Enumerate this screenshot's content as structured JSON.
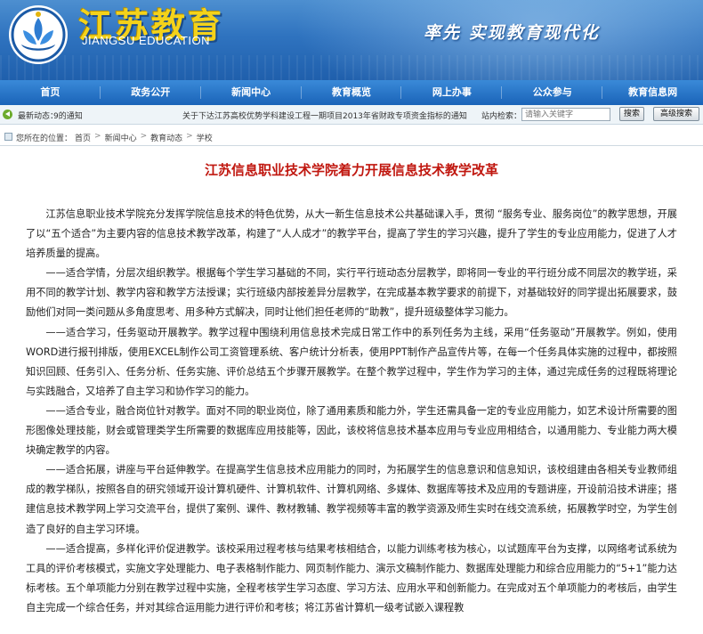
{
  "header": {
    "logo_cn": "江苏教育",
    "logo_en": "JIANGSU EDUCATION",
    "slogan": "率先 实现教育现代化",
    "colors": {
      "banner": "#2f73bf",
      "logo_text": "#f4d21a"
    }
  },
  "nav": {
    "items": [
      "首页",
      "政务公开",
      "新闻中心",
      "教育概览",
      "网上办事",
      "公众参与",
      "教育信息网"
    ]
  },
  "ticker": {
    "label": "最新动态：",
    "news1": "9的通知",
    "news2": "关于下达江苏高校优势学科建设工程一期项目2013年省财政专项资金指标的通知",
    "search_label": "站内检索：",
    "search_placeholder": "请输入关键字",
    "search_button": "搜索",
    "advanced_button": "高级搜索"
  },
  "breadcrumb": {
    "label": "您所在的位置：",
    "items": [
      "首页",
      "新闻中心",
      "教育动态",
      "学校"
    ],
    "separator": ">"
  },
  "article": {
    "title": "江苏信息职业技术学院着力开展信息技术教学改革",
    "paragraphs": [
      "江苏信息职业技术学院充分发挥学院信息技术的特色优势，从大一新生信息技术公共基础课入手，贯彻 “服务专业、服务岗位”的教学思想，开展了以“五个适合”为主要内容的信息技术教学改革，构建了“人人成才”的教学平台，提高了学生的学习兴趣，提升了学生的专业应用能力，促进了人才培养质量的提高。",
      "——适合学情，分层次组织教学。根据每个学生学习基础的不同，实行平行班动态分层教学，即将同一专业的平行班分成不同层次的教学班，采用不同的教学计划、教学内容和教学方法授课；实行班级内部按差异分层教学，在完成基本教学要求的前提下，对基础较好的同学提出拓展要求，鼓励他们对同一类问题从多角度思考、用多种方式解决，同时让他们担任老师的“助教”，提升班级整体学习能力。",
      "——适合学习，任务驱动开展教学。教学过程中围绕利用信息技术完成日常工作中的系列任务为主线，采用“任务驱动”开展教学。例如，使用WORD进行报刊排版，使用EXCEL制作公司工资管理系统、客户统计分析表，使用PPT制作产品宣传片等，在每一个任务具体实施的过程中，都按照知识回顾、任务引入、任务分析、任务实施、评价总结五个步骤开展教学。在整个教学过程中，学生作为学习的主体，通过完成任务的过程既将理论与实践融合，又培养了自主学习和协作学习的能力。",
      "——适合专业，融合岗位针对教学。面对不同的职业岗位，除了通用素质和能力外，学生还需具备一定的专业应用能力，如艺术设计所需要的图形图像处理技能，财会或管理类学生所需要的数据库应用技能等，因此，该校将信息技术基本应用与专业应用相结合，以通用能力、专业能力两大模块确定教学的内容。",
      "——适合拓展，讲座与平台延伸教学。在提高学生信息技术应用能力的同时，为拓展学生的信息意识和信息知识，该校组建由各相关专业教师组成的教学梯队，按照各自的研究领域开设计算机硬件、计算机软件、计算机网络、多媒体、数据库等技术及应用的专题讲座，开设前沿技术讲座；搭建信息技术教学网上学习交流平台，提供了案例、课件、教材教辅、教学视频等丰富的教学资源及师生实时在线交流系统，拓展教学时空，为学生创造了良好的自主学习环境。",
      "——适合提高，多样化评价促进教学。该校采用过程考核与结果考核相结合，以能力训练考核为核心，以试题库平台为支撑，以网络考试系统为工具的评价考核模式，实施文字处理能力、电子表格制作能力、网页制作能力、演示文稿制作能力、数据库处理能力和综合应用能力的“5+1”能力达标考核。五个单项能力分别在教学过程中实施，全程考核学生学习态度、学习方法、应用水平和创新能力。在完成对五个单项能力的考核后，由学生自主完成一个综合任务，并对其综合运用能力进行评价和考核；将江苏省计算机一级考试嵌入课程教"
    ]
  }
}
